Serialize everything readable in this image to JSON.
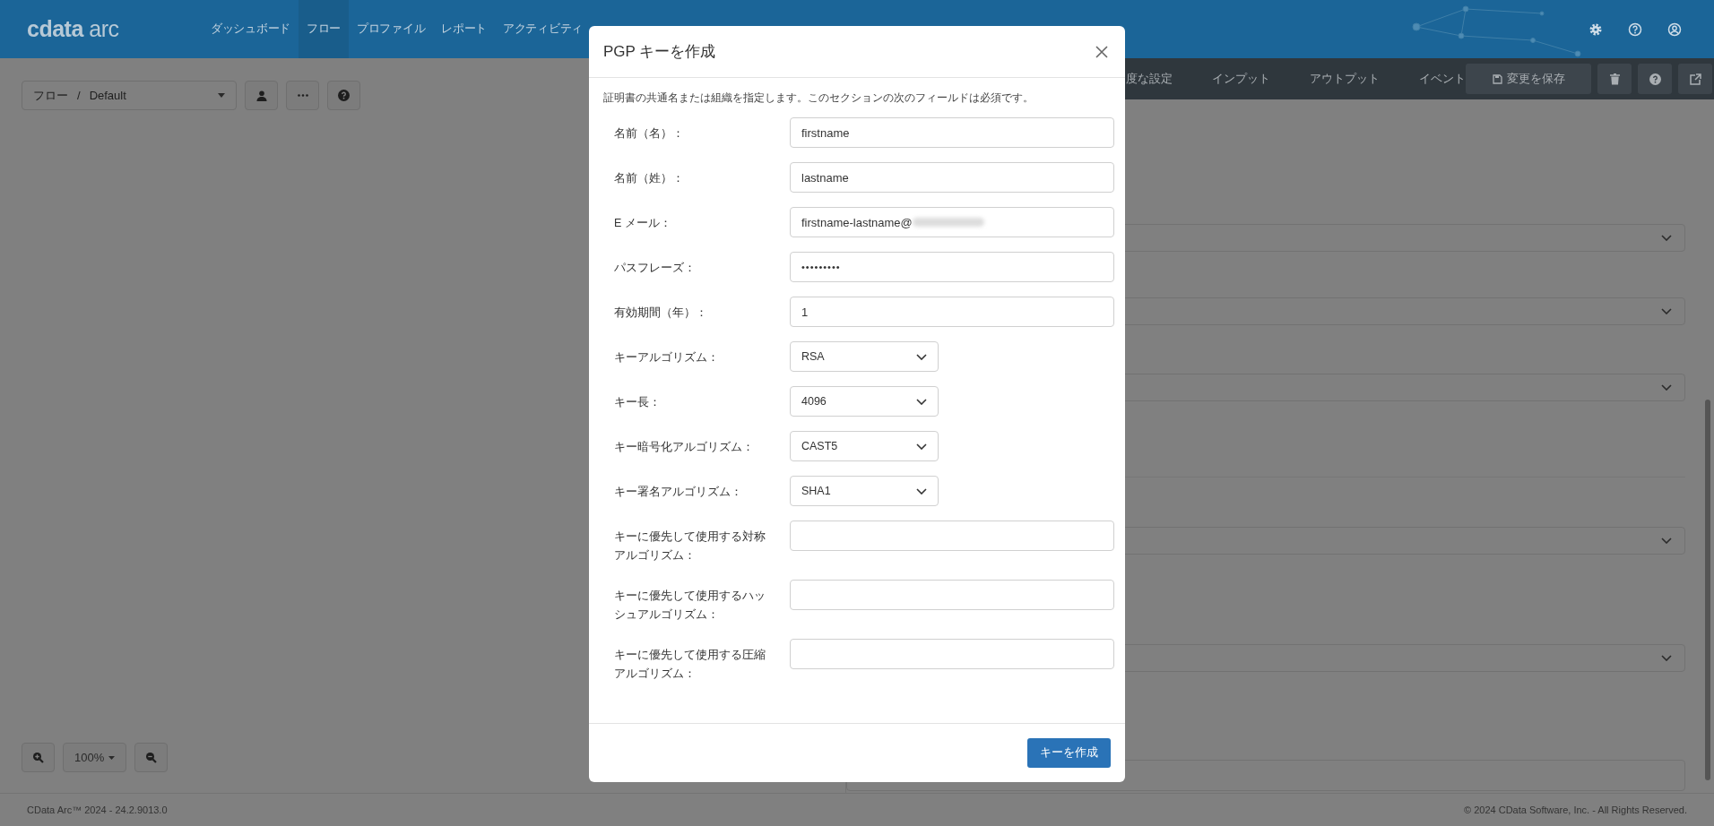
{
  "app": {
    "logo": {
      "brand": "cdata",
      "product": "arc"
    },
    "nav": [
      {
        "label": "ダッシュボード",
        "selected": false
      },
      {
        "label": "フロー",
        "selected": true
      },
      {
        "label": "プロファイル",
        "selected": false
      },
      {
        "label": "レポート",
        "selected": false
      },
      {
        "label": "アクティビティ",
        "selected": false
      }
    ]
  },
  "breadcrumb": {
    "root": "フロー",
    "separator": "/",
    "current": "Default"
  },
  "zoom": {
    "value": "100%"
  },
  "right_panel": {
    "tabs": [
      {
        "label": "度な設定"
      },
      {
        "label": "インプット"
      },
      {
        "label": "アウトプット"
      },
      {
        "label": "イベント"
      }
    ],
    "save_button": "変更を保存"
  },
  "dialog": {
    "title": "PGP キーを作成",
    "description": "証明書の共通名または組織を指定します。このセクションの次のフィールドは必須です。",
    "fields": [
      {
        "kind": "text",
        "label": "名前（名）：",
        "value": "firstname"
      },
      {
        "kind": "text",
        "label": "名前（姓）：",
        "value": "lastname"
      },
      {
        "kind": "text",
        "label": "E メール：",
        "value": "firstname-lastname@",
        "redacted": true
      },
      {
        "kind": "password",
        "label": "パスフレーズ：",
        "value": "•••••••••"
      },
      {
        "kind": "text",
        "label": "有効期間（年）：",
        "value": "1"
      },
      {
        "kind": "select",
        "label": "キーアルゴリズム：",
        "value": "RSA"
      },
      {
        "kind": "select",
        "label": "キー長：",
        "value": "4096"
      },
      {
        "kind": "select",
        "label": "キー暗号化アルゴリズム：",
        "value": "CAST5"
      },
      {
        "kind": "select",
        "label": "キー署名アルゴリズム：",
        "value": "SHA1"
      },
      {
        "kind": "text",
        "label": "キーに優先して使用する対称アルゴリズム："
      },
      {
        "kind": "text",
        "label": "キーに優先して使用するハッシュアルゴリズム："
      },
      {
        "kind": "text",
        "label": "キーに優先して使用する圧縮アルゴリズム："
      }
    ],
    "submit": "キーを作成"
  },
  "footer": {
    "version": "CData Arc™ 2024 - 24.2.9013.0",
    "copyright": "© 2024 CData Software, Inc. - All Rights Reserved."
  }
}
